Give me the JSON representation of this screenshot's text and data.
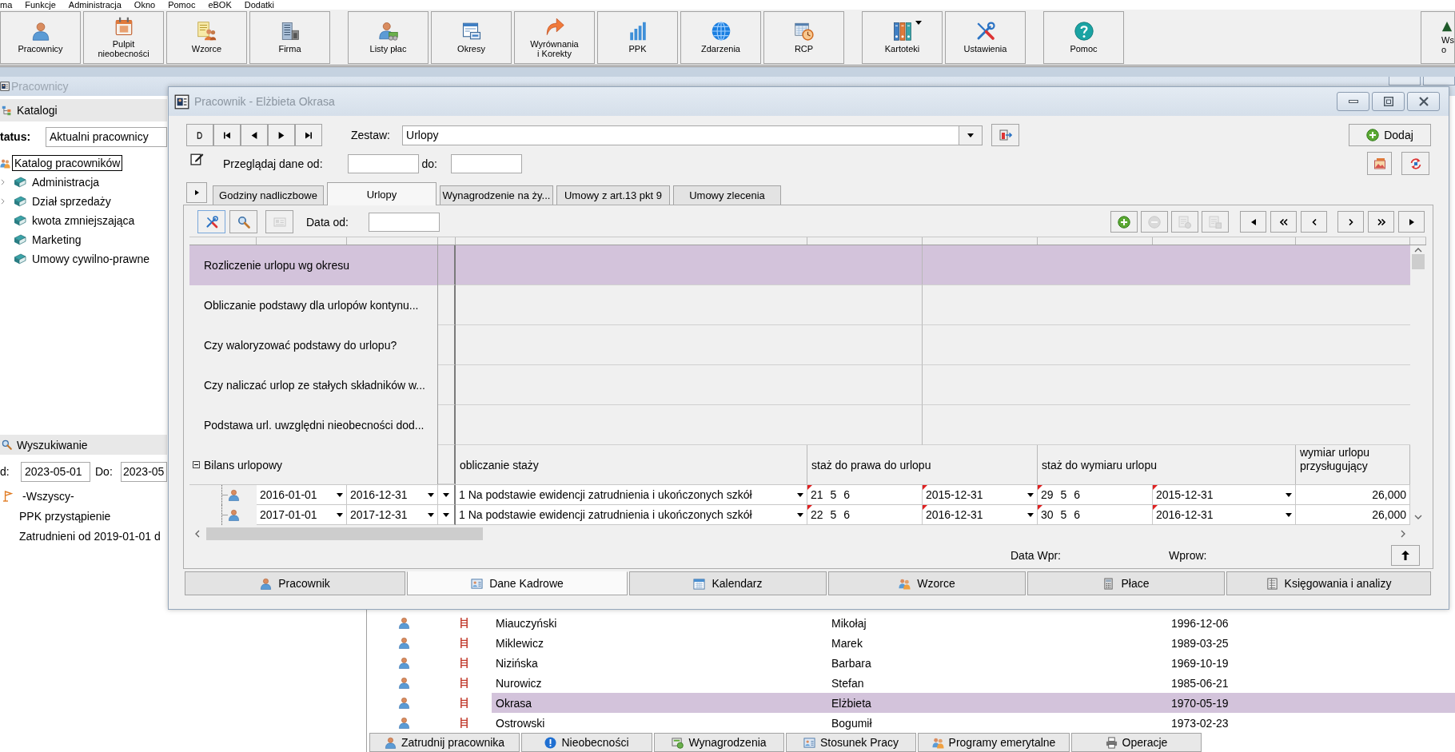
{
  "menu": [
    "ma",
    "Funkcje",
    "Administracja",
    "Okno",
    "Pomoc",
    "eBOK",
    "Dodatki"
  ],
  "toolbar": {
    "groups": [
      {
        "buttons": [
          {
            "lines": [
              "Pracownicy"
            ],
            "dropdown": false
          },
          {
            "lines": [
              "Pulpit",
              "nieobecności"
            ],
            "dropdown": false
          },
          {
            "lines": [
              "Wzorce"
            ],
            "dropdown": false
          },
          {
            "lines": [
              "Firma"
            ],
            "dropdown": false
          }
        ]
      },
      {
        "buttons": [
          {
            "lines": [
              "Listy płac"
            ],
            "dropdown": false
          },
          {
            "lines": [
              "Okresy"
            ],
            "dropdown": false
          },
          {
            "lines": [
              "Wyrównania",
              "i Korekty"
            ],
            "dropdown": false
          },
          {
            "lines": [
              "PPK"
            ],
            "dropdown": false
          },
          {
            "lines": [
              "Zdarzenia"
            ],
            "dropdown": false
          },
          {
            "lines": [
              "RCP"
            ],
            "dropdown": false
          }
        ]
      },
      {
        "buttons": [
          {
            "lines": [
              "Kartoteki"
            ],
            "dropdown": true
          },
          {
            "lines": [
              "Ustawienia"
            ],
            "dropdown": false
          }
        ]
      },
      {
        "buttons": [
          {
            "lines": [
              "Pomoc"
            ],
            "dropdown": false
          }
        ]
      },
      {
        "buttons": [
          {
            "lines": [
              "Ws",
              "o"
            ],
            "dropdown": false
          }
        ]
      }
    ]
  },
  "employees_window": {
    "title": "Pracownicy",
    "catalogs": {
      "title": "Katalogi",
      "status_label": "tatus:",
      "status_value": "Aktualni pracownicy",
      "tree": [
        {
          "label": "Katalog pracowników",
          "selected": true,
          "children": [
            {
              "label": "Administracja",
              "has_children": true,
              "selected": false
            },
            {
              "label": "Dział sprzedaży",
              "has_children": true,
              "selected": false
            },
            {
              "label": "kwota zmniejszająca",
              "has_children": false,
              "selected": false
            },
            {
              "label": "Marketing",
              "has_children": false,
              "selected": false
            },
            {
              "label": "Umowy cywilno-prawne",
              "has_children": false,
              "selected": false
            }
          ]
        }
      ]
    },
    "search": {
      "title": "Wyszukiwanie",
      "from_label": "d:",
      "from_value": "2023-05-01",
      "to_label": "Do:",
      "to_value": "2023-05",
      "filters": [
        {
          "label": "-Wszyscy-",
          "kind": "group"
        },
        {
          "label": "PPK przystąpienie",
          "kind": "filter"
        },
        {
          "label": "Zatrudnieni od 2019-01-01 d",
          "kind": "filter"
        }
      ]
    },
    "employees": [
      {
        "surname": "Miauczyński",
        "first_name": "Mikołaj",
        "date": "1996-12-06",
        "selected": false
      },
      {
        "surname": "Miklewicz",
        "first_name": "Marek",
        "date": "1989-03-25",
        "selected": false
      },
      {
        "surname": "Nizińska",
        "first_name": "Barbara",
        "date": "1969-10-19",
        "selected": false
      },
      {
        "surname": "Nurowicz",
        "first_name": "Stefan",
        "date": "1985-06-21",
        "selected": false
      },
      {
        "surname": "Okrasa",
        "first_name": "Elżbieta",
        "date": "1970-05-19",
        "selected": true
      },
      {
        "surname": "Ostrowski",
        "first_name": "Bogumił",
        "date": "1973-02-23",
        "selected": false
      }
    ],
    "actions": [
      "Zatrudnij pracownika",
      "Nieobecności",
      "Wynagrodzenia",
      "Stosunek Pracy",
      "Programy emerytalne",
      "Operacje"
    ]
  },
  "dialog": {
    "title": "Pracownik - Elżbieta Okrasa",
    "set_label": "Zestaw:",
    "set_value": "Urlopy",
    "add_button": "Dodaj",
    "browse_label": "Przeglądaj dane od:",
    "browse_to_label": "do:",
    "tabs": [
      {
        "label": "Godziny nadliczbowe",
        "selected": false
      },
      {
        "label": "Urlopy",
        "selected": true
      },
      {
        "label": "Wynagrodzenie na ży...",
        "selected": false
      },
      {
        "label": "Umowy z art.13 pkt 9",
        "selected": false
      },
      {
        "label": "Umowy zlecenia",
        "selected": false
      }
    ],
    "view_tools": [
      {
        "disabled": false
      },
      {
        "disabled": false
      },
      {
        "disabled": true
      }
    ],
    "date_from_label": "Data od:",
    "edit_tools": [
      {
        "disabled": false
      },
      {
        "disabled": true
      },
      {
        "disabled": true
      },
      {
        "disabled": true
      }
    ],
    "settings": [
      {
        "label": "Rozliczenie urlopu wg okresu",
        "selected": true
      },
      {
        "label": "Obliczanie podstawy dla urlopów kontynu...",
        "selected": false
      },
      {
        "label": "Czy waloryzować podstawy do urlopu?",
        "selected": false
      },
      {
        "label": "Czy naliczać urlop ze stałych składników w...",
        "selected": false
      },
      {
        "label": "Podstawa url. uwzględni nieobecności dod...",
        "selected": false
      }
    ],
    "balance": {
      "label": "Bilans urlopowy",
      "expanded": true,
      "columns": [
        "obliczanie staży",
        "staż do prawa do urlopu",
        "staż do wymiaru urlopu",
        "wymiar urlopu przysługujący"
      ],
      "rows": [
        {
          "from": "2016-01-01",
          "to": "2016-12-31",
          "method": "1 Na podstawie ewidencji zatrudnienia i ukończonych szkół",
          "right_seniority": "21 5 6",
          "right_date": "2015-12-31",
          "measure_seniority": "29 5 6",
          "measure_date": "2015-12-31",
          "entitlement": "26,000",
          "flagged": true
        },
        {
          "from": "2017-01-01",
          "to": "2017-12-31",
          "method": "1 Na podstawie ewidencji zatrudnienia i ukończonych szkół",
          "right_seniority": "22 5 6",
          "right_date": "2016-12-31",
          "measure_seniority": "30 5 6",
          "measure_date": "2016-12-31",
          "entitlement": "26,000",
          "flagged": true
        }
      ]
    },
    "footer": {
      "entry_date_label": "Data Wpr:",
      "entered_by_label": "Wprow:"
    },
    "bottom_tabs": [
      {
        "label": "Pracownik",
        "selected": false
      },
      {
        "label": "Dane Kadrowe",
        "selected": true
      },
      {
        "label": "Kalendarz",
        "selected": false
      },
      {
        "label": "Wzorce",
        "selected": false
      },
      {
        "label": "Płace",
        "selected": false
      },
      {
        "label": "Księgowania i analizy",
        "selected": false
      }
    ]
  }
}
